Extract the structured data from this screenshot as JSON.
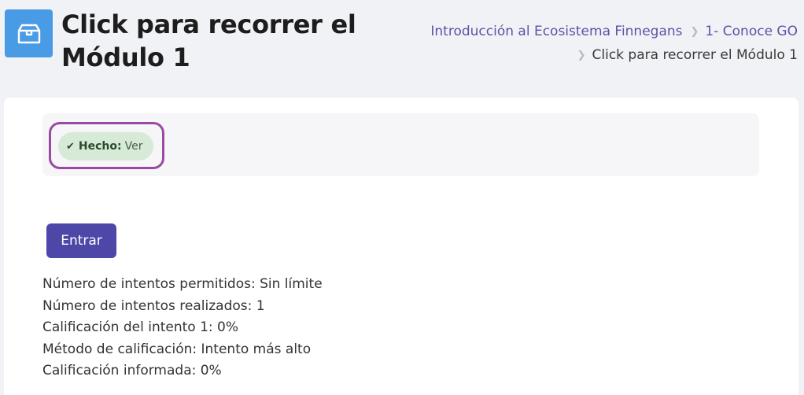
{
  "header": {
    "title": "Click para recorrer el Módulo 1",
    "icon": "box-icon"
  },
  "breadcrumb": {
    "items": [
      {
        "label": "Introducción al Ecosistema Finnegans",
        "link": true
      },
      {
        "label": "1- Conoce GO",
        "link": true
      },
      {
        "label": "Click para recorrer el Módulo 1",
        "link": false
      }
    ]
  },
  "completion": {
    "status_label": "Hecho:",
    "action_label": "Ver",
    "icon": "check-icon"
  },
  "actions": {
    "enter_label": "Entrar"
  },
  "attempts": [
    "Número de intentos permitidos: Sin límite",
    "Número de intentos realizados: 1",
    "Calificación del intento 1: 0%",
    "Método de calificación: Intento más alto",
    "Calificación informada: 0%"
  ],
  "colors": {
    "icon_bg": "#4a9be5",
    "link": "#5b52a8",
    "button": "#4d47a7",
    "badge_bg": "#d6ead7",
    "highlight": "#9b4aa1"
  }
}
